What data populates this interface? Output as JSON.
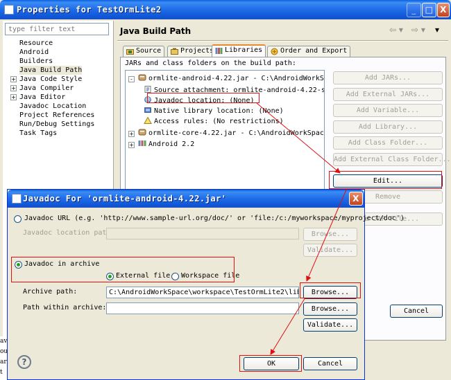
{
  "window": {
    "title": "Properties for TestOrmLite2",
    "min": "_",
    "max": "□",
    "close": "X"
  },
  "nav": {
    "filter_placeholder": "type filter text",
    "items": [
      {
        "label": "Resource",
        "expandable": false
      },
      {
        "label": "Android",
        "expandable": false
      },
      {
        "label": "Builders",
        "expandable": false
      },
      {
        "label": "Java Build Path",
        "expandable": false,
        "selected": true
      },
      {
        "label": "Java Code Style",
        "expandable": true
      },
      {
        "label": "Java Compiler",
        "expandable": true
      },
      {
        "label": "Java Editor",
        "expandable": true
      },
      {
        "label": "Javadoc Location",
        "expandable": false
      },
      {
        "label": "Project References",
        "expandable": false
      },
      {
        "label": "Run/Debug Settings",
        "expandable": false
      },
      {
        "label": "Task Tags",
        "expandable": false
      }
    ],
    "expand_glyph": "+"
  },
  "page": {
    "title": "Java Build Path",
    "back": "⇦ ▾",
    "forward": "⇨ ▾",
    "menu": "▾",
    "tabs": [
      "Source",
      "Projects",
      "Libraries",
      "Order and Export"
    ],
    "active_tab": 2,
    "jars_label": "JARs and class folders on the build path:",
    "tree": [
      {
        "text": "ormlite-android-4.22.jar - C:\\AndroidWorkSpace\\wo",
        "exp": "-"
      },
      {
        "text": "Source attachment: ormlite-android-4.22-source"
      },
      {
        "text": "Javadoc location: (None)"
      },
      {
        "text": "Native library location: (None)"
      },
      {
        "text": "Access rules: (No restrictions)"
      },
      {
        "text": "ormlite-core-4.22.jar - C:\\AndroidWorkSpace\\works",
        "exp": "+"
      },
      {
        "text": "Android 2.2",
        "exp": "+"
      }
    ],
    "buttons": [
      {
        "label": "Add JARs...",
        "enabled": false
      },
      {
        "label": "Add External JARs...",
        "enabled": false
      },
      {
        "label": "Add Variable...",
        "enabled": false
      },
      {
        "label": "Add Library...",
        "enabled": false
      },
      {
        "label": "Add Class Folder...",
        "enabled": false
      },
      {
        "label": "Add External Class Folder...",
        "enabled": false
      },
      {
        "label": "Edit...",
        "enabled": true
      },
      {
        "label": "Remove",
        "enabled": false
      },
      {
        "label": "ate JAR File...",
        "enabled": false
      }
    ],
    "bottom_cancel": "Cancel"
  },
  "dialog": {
    "title": "Javadoc For 'ormlite-android-4.22.jar'",
    "url_radio": "Javadoc URL (e.g. 'http://www.sample-url.org/doc/' or 'file:/c:/myworkspace/myproject/doc')",
    "location_path_label": "Javadoc location path:",
    "browse1": "Browse...",
    "validate1": "Validate...",
    "archive_radio": "Javadoc in archive",
    "external_file": "External file",
    "workspace_file": "Workspace file",
    "archive_path_label": "Archive path:",
    "archive_path_value": "C:\\AndroidWorkSpace\\workspace\\TestOrmLite2\\lib\\ormlite",
    "browse2": "Browse...",
    "path_within_label": "Path within archive:",
    "path_within_value": "",
    "browse3": "Browse...",
    "validate2": "Validate...",
    "help": "?",
    "ok": "OK",
    "cancel": "Cancel"
  },
  "background_fragments": [
    "av",
    "ou",
    "ar",
    "t",
    "do"
  ],
  "colors": {
    "title_blue": "#1f6be8",
    "dialog_face": "#ece9d8",
    "annotation_red": "#e01010"
  }
}
